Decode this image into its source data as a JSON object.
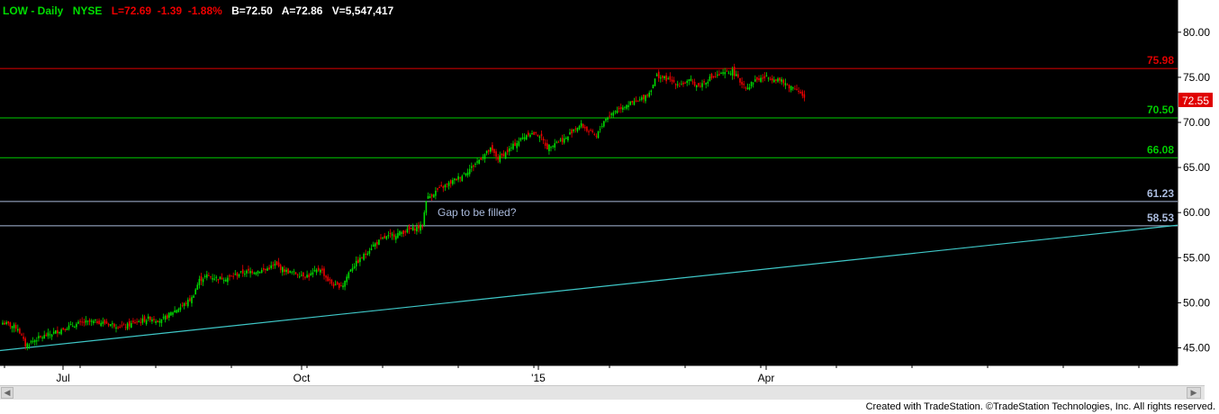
{
  "header": {
    "symbol": "LOW - Daily",
    "exchange": "NYSE",
    "quote": "L=72.69  -1.39  -1.88%",
    "bid": "B=72.50",
    "ask": "A=72.86",
    "volume": "V=5,547,417"
  },
  "annotation": "Gap to be filled?",
  "credit": "Created with TradeStation. ©TradeStation Technologies, Inc. All rights reserved.",
  "colors": {
    "background": "#000000",
    "up_candle": "#00dd00",
    "down_candle": "#ee0000",
    "resistance": "#e00000",
    "support_green": "#00cc00",
    "support_blue": "#aabbdd",
    "trendline": "#3fc8c8"
  },
  "icons": {
    "scroll_left": "arrow-left-icon",
    "scroll_right": "arrow-right-icon"
  },
  "chart_data": {
    "type": "candlestick",
    "symbol": "LOW",
    "interval": "Daily",
    "y_axis": {
      "ticks": [
        "80.00",
        "75.00",
        "70.00",
        "65.00",
        "60.00",
        "55.00",
        "50.00",
        "45.00"
      ],
      "range": [
        43.5,
        82.5
      ]
    },
    "x_axis": {
      "labels": [
        "Jul",
        "Oct",
        "'15",
        "Apr"
      ]
    },
    "last_price": "72.55",
    "horizontal_levels": [
      {
        "label": "75.98",
        "value": 75.98,
        "color": "#e00000"
      },
      {
        "label": "70.50",
        "value": 70.5,
        "color": "#00cc00"
      },
      {
        "label": "66.08",
        "value": 66.08,
        "color": "#00cc00"
      },
      {
        "label": "61.23",
        "value": 61.23,
        "color": "#aabbdd"
      },
      {
        "label": "58.53",
        "value": 58.53,
        "color": "#aabbdd"
      }
    ],
    "trendline": {
      "start_value": 44.7,
      "end_value": 58.6,
      "color": "#3fc8c8"
    },
    "close_path": [
      [
        0,
        47.8
      ],
      [
        8,
        47.2
      ],
      [
        12,
        45.3
      ],
      [
        18,
        46.0
      ],
      [
        26,
        46.6
      ],
      [
        34,
        47.3
      ],
      [
        42,
        47.8
      ],
      [
        50,
        47.9
      ],
      [
        58,
        47.6
      ],
      [
        64,
        47.3
      ],
      [
        70,
        47.8
      ],
      [
        78,
        48.3
      ],
      [
        84,
        48.0
      ],
      [
        90,
        49.0
      ],
      [
        96,
        49.8
      ],
      [
        100,
        50.5
      ],
      [
        104,
        52.5
      ],
      [
        108,
        53.0
      ],
      [
        114,
        52.7
      ],
      [
        120,
        52.8
      ],
      [
        126,
        53.3
      ],
      [
        132,
        53.5
      ],
      [
        138,
        53.6
      ],
      [
        144,
        54.2
      ],
      [
        150,
        53.5
      ],
      [
        156,
        53.2
      ],
      [
        162,
        53.0
      ],
      [
        168,
        53.8
      ],
      [
        172,
        52.5
      ],
      [
        176,
        51.8
      ],
      [
        180,
        52.0
      ],
      [
        184,
        53.8
      ],
      [
        190,
        55.0
      ],
      [
        196,
        56.4
      ],
      [
        202,
        57.2
      ],
      [
        208,
        57.6
      ],
      [
        214,
        58.0
      ],
      [
        222,
        58.5
      ],
      [
        224,
        61.5
      ],
      [
        230,
        62.5
      ],
      [
        236,
        63.2
      ],
      [
        242,
        64.0
      ],
      [
        248,
        65.0
      ],
      [
        254,
        66.3
      ],
      [
        258,
        67.0
      ],
      [
        262,
        66.0
      ],
      [
        266,
        66.6
      ],
      [
        272,
        67.8
      ],
      [
        278,
        68.8
      ],
      [
        284,
        68.6
      ],
      [
        288,
        67.2
      ],
      [
        292,
        67.8
      ],
      [
        298,
        68.2
      ],
      [
        302,
        69.3
      ],
      [
        306,
        69.7
      ],
      [
        310,
        69.0
      ],
      [
        314,
        68.4
      ],
      [
        318,
        70.2
      ],
      [
        324,
        71.3
      ],
      [
        330,
        72.0
      ],
      [
        336,
        72.3
      ],
      [
        342,
        73.3
      ],
      [
        346,
        75.2
      ],
      [
        352,
        74.7
      ],
      [
        358,
        74.2
      ],
      [
        364,
        74.6
      ],
      [
        368,
        74.0
      ],
      [
        374,
        74.9
      ],
      [
        380,
        75.3
      ],
      [
        386,
        75.7
      ],
      [
        390,
        74.5
      ],
      [
        394,
        73.9
      ],
      [
        398,
        74.7
      ],
      [
        404,
        75.0
      ],
      [
        410,
        74.8
      ],
      [
        416,
        74.0
      ],
      [
        420,
        73.8
      ],
      [
        424,
        72.6
      ]
    ]
  }
}
